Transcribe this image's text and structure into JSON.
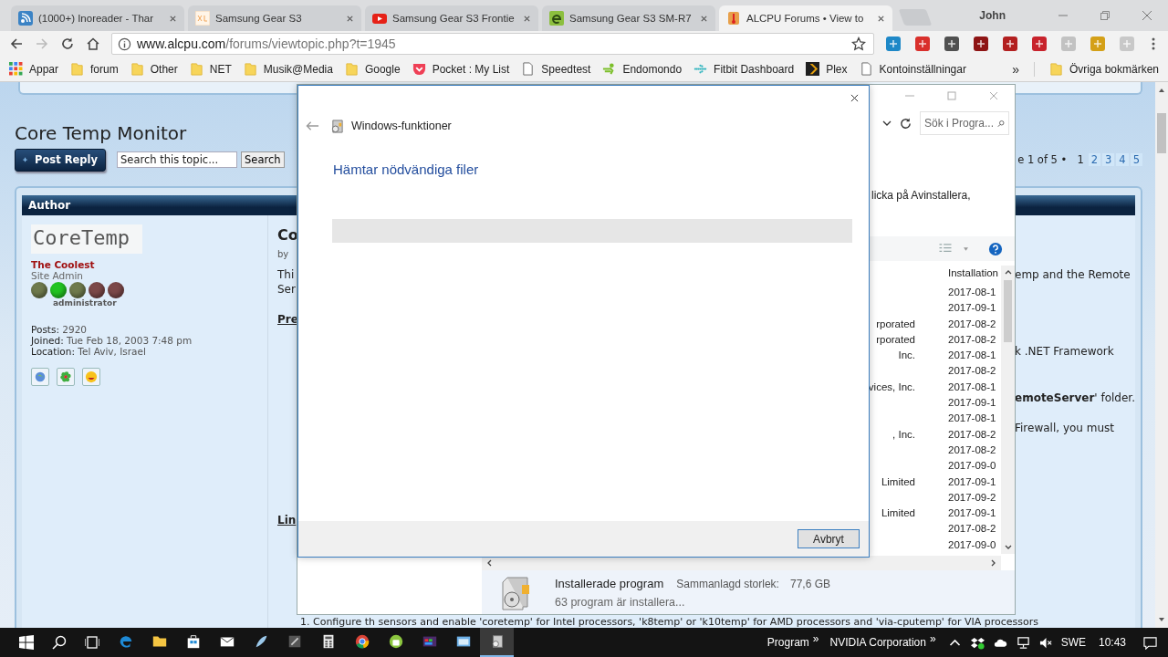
{
  "browser": {
    "tabs": [
      {
        "title": "(1000+) Inoreader - Thar",
        "kind": "rss",
        "selected": false
      },
      {
        "title": "Samsung Gear S3",
        "kind": "xda",
        "selected": false
      },
      {
        "title": "Samsung Gear S3 Frontie",
        "kind": "video",
        "selected": false
      },
      {
        "title": "Samsung Gear S3 SM-R7",
        "kind": "letter",
        "selected": false
      },
      {
        "title": "ALCPU Forums • View to",
        "kind": "thermometer",
        "selected": true
      }
    ],
    "profile": "John",
    "url_host": "www.alcpu.com",
    "url_path": "/forums/viewtopic.php?t=1945",
    "extensions": [
      {
        "color": "#1e88c7"
      },
      {
        "color": "#d9302c"
      },
      {
        "color": "#505050"
      },
      {
        "color": "#8e1414"
      },
      {
        "color": "#b32020"
      },
      {
        "color": "#c8232c"
      },
      {
        "color": "#c2c2c2"
      },
      {
        "color": "#d4a017"
      },
      {
        "color": "#c8c8c8"
      }
    ],
    "bookmarks": [
      {
        "label": "Appar",
        "kind": "apps"
      },
      {
        "label": "forum",
        "kind": "folder"
      },
      {
        "label": "Other",
        "kind": "folder"
      },
      {
        "label": "NET",
        "kind": "folder"
      },
      {
        "label": "Musik@Media",
        "kind": "folder"
      },
      {
        "label": "Google",
        "kind": "folder"
      },
      {
        "label": "Pocket : My List",
        "kind": "pocket"
      },
      {
        "label": "Speedtest",
        "kind": "page"
      },
      {
        "label": "Endomondo",
        "kind": "runner"
      },
      {
        "label": "Fitbit Dashboard",
        "kind": "dots"
      },
      {
        "label": "Plex",
        "kind": "chevron"
      },
      {
        "label": "Kontoinställningar",
        "kind": "page"
      }
    ],
    "more_bookmarks": "»",
    "other_bookmarks": "Övriga bokmärken"
  },
  "forum": {
    "topic_title": "Core Temp Monitor",
    "post_reply": "Post Reply",
    "search_placeholder": "Search this topic...",
    "search_button": "Search",
    "pagination_prefix": "e 1 of 5 •",
    "pages": [
      {
        "label": "1",
        "selected": true
      },
      {
        "label": "2",
        "selected": false
      },
      {
        "label": "3",
        "selected": false
      },
      {
        "label": "4",
        "selected": false
      },
      {
        "label": "5",
        "selected": false
      }
    ],
    "author_header": "Author",
    "avatar_text": "CoreTemp",
    "rank_title": "The Coolest",
    "rank": "Site Admin",
    "rank_lights": [
      {
        "color": "#6f7a4c"
      },
      {
        "color": "#22c422"
      },
      {
        "color": "#6f7a4c"
      },
      {
        "color": "#7c4848"
      },
      {
        "color": "#7c4848"
      }
    ],
    "rank_caption": "administrator",
    "profile_fields": [
      {
        "label": "Posts:",
        "value": "2920"
      },
      {
        "label": "Joined:",
        "value": "Tue Feb 18, 2003 7:48 pm"
      },
      {
        "label": "Location:",
        "value": "Tel Aviv, Israel"
      }
    ],
    "contact_icons": [
      {
        "kind": "globe"
      },
      {
        "kind": "flower"
      },
      {
        "kind": "smiley"
      }
    ],
    "post_lines": [
      {
        "kind": "title",
        "left": "Co"
      },
      {
        "kind": "meta",
        "left": "by"
      },
      {
        "kind": "body",
        "left": "Thi",
        "right": "emp and the Remote"
      },
      {
        "kind": "body",
        "left": "Ser"
      },
      {
        "kind": "heading",
        "left": "Pre"
      },
      {
        "kind": "body",
        "right": "k .NET Framework"
      },
      {
        "kind": "body",
        "right": "**emoteServer**' folder."
      },
      {
        "kind": "body",
        "right": "Firewall, you must"
      },
      {
        "kind": "heading",
        "left": "Lin"
      },
      {
        "kind": "list",
        "left": "1. Configure th sensors and enable 'coretemp' for Intel processors, 'k8temp' or 'k10temp' for AMD processors and 'via-cputemp' for VIA processors"
      }
    ]
  },
  "programs_window": {
    "search_placeholder": "Sök i Progra...",
    "description": "licka på Avinstallera,",
    "column_header": "Installation",
    "rows": [
      {
        "date": "2017-08-1"
      },
      {
        "date": "2017-09-1"
      },
      {
        "publisher": "rporated",
        "date": "2017-08-2"
      },
      {
        "publisher": "rporated",
        "date": "2017-08-2"
      },
      {
        "publisher": "Inc.",
        "date": "2017-08-1"
      },
      {
        "date": "2017-08-2"
      },
      {
        "publisher": "vices, Inc.",
        "date": "2017-08-1"
      },
      {
        "date": "2017-09-1"
      },
      {
        "date": "2017-08-1"
      },
      {
        "publisher": ", Inc.",
        "date": "2017-08-2"
      },
      {
        "date": "2017-08-2"
      },
      {
        "date": "2017-09-0"
      },
      {
        "publisher": "Limited",
        "date": "2017-09-1"
      },
      {
        "date": "2017-09-2"
      },
      {
        "publisher": "Limited",
        "date": "2017-09-1"
      },
      {
        "date": "2017-08-2"
      },
      {
        "date": "2017-09-0"
      }
    ],
    "details_title": "Installerade program",
    "details_size_label": "Sammanlagd storlek:",
    "details_size": "77,6 GB",
    "details_count": "63 program är installera..."
  },
  "dialog": {
    "title": "Windows-funktioner",
    "heading": "Hämtar nödvändiga filer",
    "level": 0,
    "cancel": "Avbryt"
  },
  "taskbar": {
    "apps": [
      {
        "kind": "edge",
        "selected": false
      },
      {
        "kind": "folder",
        "selected": false
      },
      {
        "kind": "store",
        "selected": false
      },
      {
        "kind": "mail",
        "selected": false
      },
      {
        "kind": "feather",
        "selected": false
      },
      {
        "kind": "monitor",
        "selected": false
      },
      {
        "kind": "calculator",
        "selected": false
      },
      {
        "kind": "chrome",
        "selected": false
      },
      {
        "kind": "android",
        "selected": false
      },
      {
        "kind": "tiles",
        "selected": false
      },
      {
        "kind": "window",
        "selected": false
      },
      {
        "kind": "box",
        "selected": true
      }
    ],
    "toolbars": [
      {
        "label": "Program",
        "more": "»"
      },
      {
        "label": "NVIDIA Corporation",
        "more": "»"
      }
    ],
    "language": "SWE",
    "time": "10:43"
  }
}
